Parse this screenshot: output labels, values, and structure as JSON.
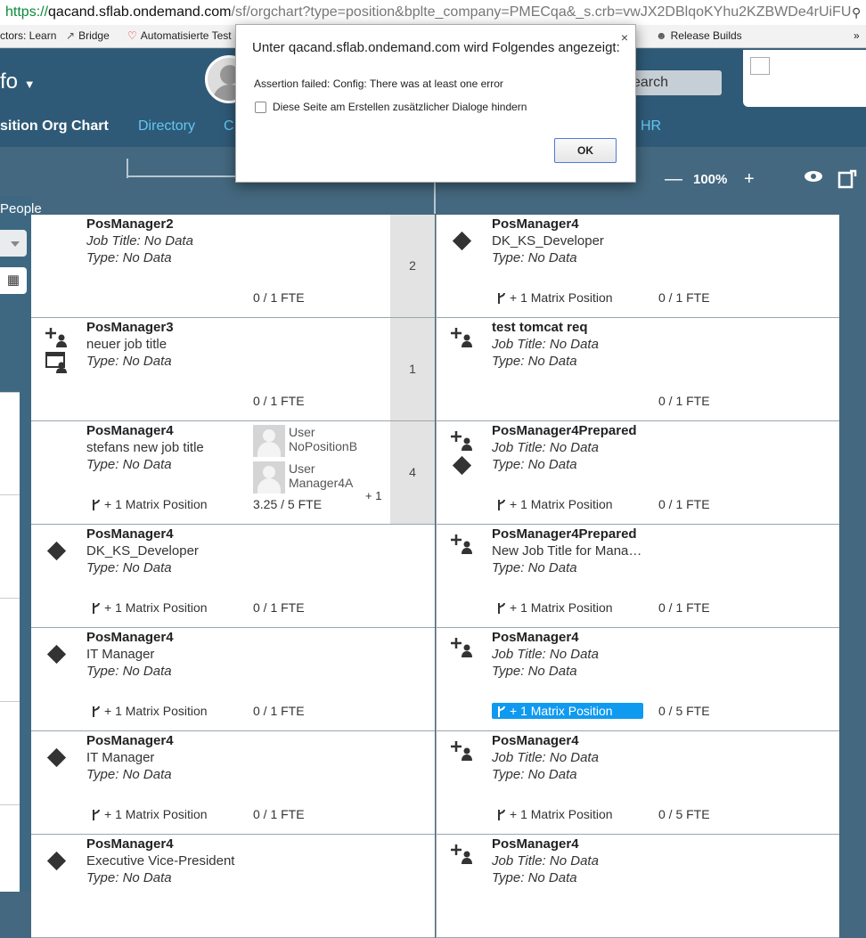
{
  "browser": {
    "url_proto": "https://",
    "url_host": "qacand.sflab.ondemand.com",
    "url_rest": "/sf/orgchart?type=position&bplte_company=PMECqa&_s.crb=vwJX2DBlqoKYhu2KZBWDe4rUiFU%",
    "bookmarks": [
      {
        "label": "ctors: Learn",
        "icon": ""
      },
      {
        "label": "Bridge",
        "icon": "chart-icon"
      },
      {
        "label": "Automatisierte Test",
        "icon": "heart-icon"
      },
      {
        "label": "Release Builds",
        "icon": "person-icon"
      }
    ],
    "more_bookmarks": "»"
  },
  "app": {
    "title": "fo",
    "search_placeholder": "earch",
    "nav": [
      "sition Org Chart",
      "Directory",
      "C",
      "HR"
    ]
  },
  "toolbar": {
    "zoom_out": "—",
    "zoom": "100%",
    "zoom_in": "+"
  },
  "left": {
    "people_label": "People"
  },
  "cards": [
    {
      "name": "PosManager2",
      "job": "Job Title: No Data",
      "job_italic": true,
      "type": "Type: No Data",
      "fte": "0 / 1 FTE",
      "count": "2",
      "matrix": "",
      "icon": "none"
    },
    {
      "name": "PosManager4",
      "job": "DK_KS_Developer",
      "job_italic": false,
      "type": "Type: No Data",
      "fte": "0 / 1 FTE",
      "matrix": "+ 1 Matrix Position",
      "icon": "diamond"
    },
    {
      "name": "PosManager3",
      "job": "neuer job title",
      "job_italic": false,
      "type": "Type: No Data",
      "fte": "0 / 1 FTE",
      "count": "1",
      "matrix": "",
      "icon": "add-person"
    },
    {
      "name": "test tomcat req",
      "job": "Job Title: No Data",
      "job_italic": true,
      "type": "Type: No Data",
      "fte": "0 / 1 FTE",
      "matrix": "",
      "icon": "add-person"
    },
    {
      "name": "PosManager4",
      "job": "stefans new job title",
      "job_italic": false,
      "type": "Type: No Data",
      "fte": "3.25 / 5 FTE",
      "count": "4",
      "matrix": "+ 1 Matrix Position",
      "icon": "none",
      "people": [
        "User NoPositionB",
        "User Manager4A"
      ],
      "more": "+ 1"
    },
    {
      "name": "PosManager4Prepared",
      "job": "Job Title: No Data",
      "job_italic": true,
      "type": "Type: No Data",
      "fte": "0 / 1 FTE",
      "matrix": "+ 1 Matrix Position",
      "icon": "add-person-diamond"
    },
    {
      "name": "PosManager4",
      "job": "DK_KS_Developer",
      "job_italic": false,
      "type": "Type: No Data",
      "fte": "0 / 1 FTE",
      "matrix": "+ 1 Matrix Position",
      "icon": "diamond"
    },
    {
      "name": "PosManager4Prepared",
      "job": "New Job Title for Mana…",
      "job_italic": false,
      "type": "Type: No Data",
      "fte": "0 / 1 FTE",
      "matrix": "+ 1 Matrix Position",
      "icon": "add-person"
    },
    {
      "name": "PosManager4",
      "job": "IT Manager",
      "job_italic": false,
      "type": "Type: No Data",
      "fte": "0 / 1 FTE",
      "matrix": "+ 1 Matrix Position",
      "icon": "diamond"
    },
    {
      "name": "PosManager4",
      "job": "Job Title: No Data",
      "job_italic": true,
      "type": "Type: No Data",
      "fte": "0 / 5 FTE",
      "matrix": "+ 1 Matrix Position",
      "icon": "add-person",
      "highlight": true
    },
    {
      "name": "PosManager4",
      "job": "IT Manager",
      "job_italic": false,
      "type": "Type: No Data",
      "fte": "0 / 1 FTE",
      "matrix": "+ 1 Matrix Position",
      "icon": "diamond"
    },
    {
      "name": "PosManager4",
      "job": "Job Title: No Data",
      "job_italic": true,
      "type": "Type: No Data",
      "fte": "0 / 5 FTE",
      "matrix": "+ 1 Matrix Position",
      "icon": "add-person"
    },
    {
      "name": "PosManager4",
      "job": "Executive Vice-President",
      "job_italic": false,
      "type": "Type: No Data",
      "fte": "",
      "matrix": "",
      "icon": "diamond"
    },
    {
      "name": "PosManager4",
      "job": "Job Title: No Data",
      "job_italic": true,
      "type": "Type: No Data",
      "fte": "",
      "matrix": "",
      "icon": "add-person"
    }
  ],
  "dialog": {
    "title": "Unter qacand.sflab.ondemand.com wird Folgendes angezeigt:",
    "message": "Assertion failed: Config: There was at least one error",
    "checkbox_label": "Diese Seite am Erstellen zusätzlicher Dialoge hindern",
    "ok": "OK",
    "close": "×"
  }
}
